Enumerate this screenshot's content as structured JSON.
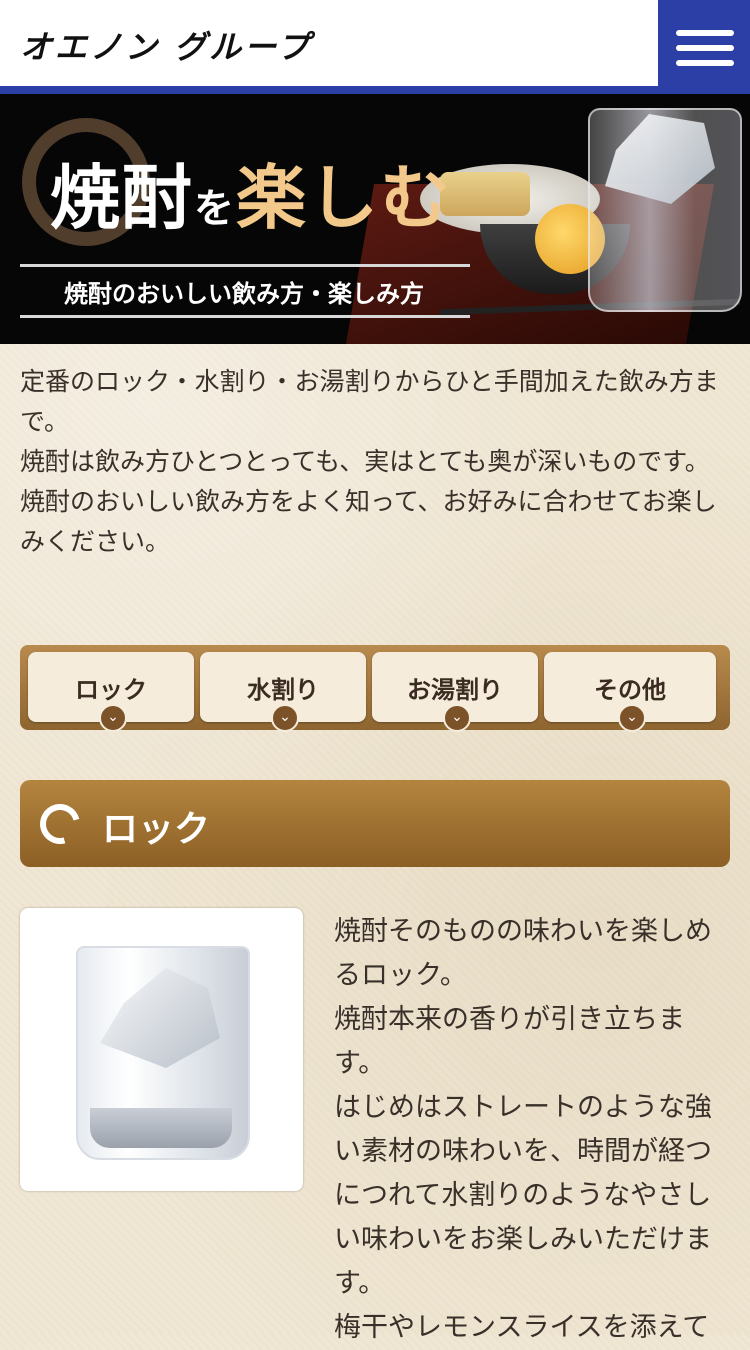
{
  "header": {
    "logo": "オエノン グループ",
    "menu_icon": "hamburger-menu-icon"
  },
  "hero": {
    "title_main": "焼酎",
    "title_particle": "を",
    "title_gold": "楽しむ",
    "subtitle": "焼酎のおいしい飲み方・楽しみ方"
  },
  "intro": {
    "p1": "定番のロック・水割り・お湯割りからひと手間加えた飲み方まで。",
    "p2": "焼酎は飲み方ひとつとっても、実はとても奥が深いものです。",
    "p3": "焼酎のおいしい飲み方をよく知って、お好みに合わせてお楽しみください。"
  },
  "tabs": [
    {
      "label": "ロック"
    },
    {
      "label": "水割り"
    },
    {
      "label": "お湯割り"
    },
    {
      "label": "その他"
    }
  ],
  "section": {
    "title": "ロック"
  },
  "content": {
    "p1": "焼酎そのものの味わいを楽しめるロック。",
    "p2": "焼酎本来の香りが引き立ちます。",
    "p3": "はじめはストレートのような強い素材の味わいを、時間が経つにつれて水割りのようなやさしい味わいをお楽しみいただけます。",
    "p4": "梅干やレモンスライスを添えて"
  },
  "colors": {
    "brand_blue": "#2b3fa7",
    "tab_brown": "#8e6530",
    "section_brown": "#b4853f",
    "background": "#efe6d3"
  }
}
